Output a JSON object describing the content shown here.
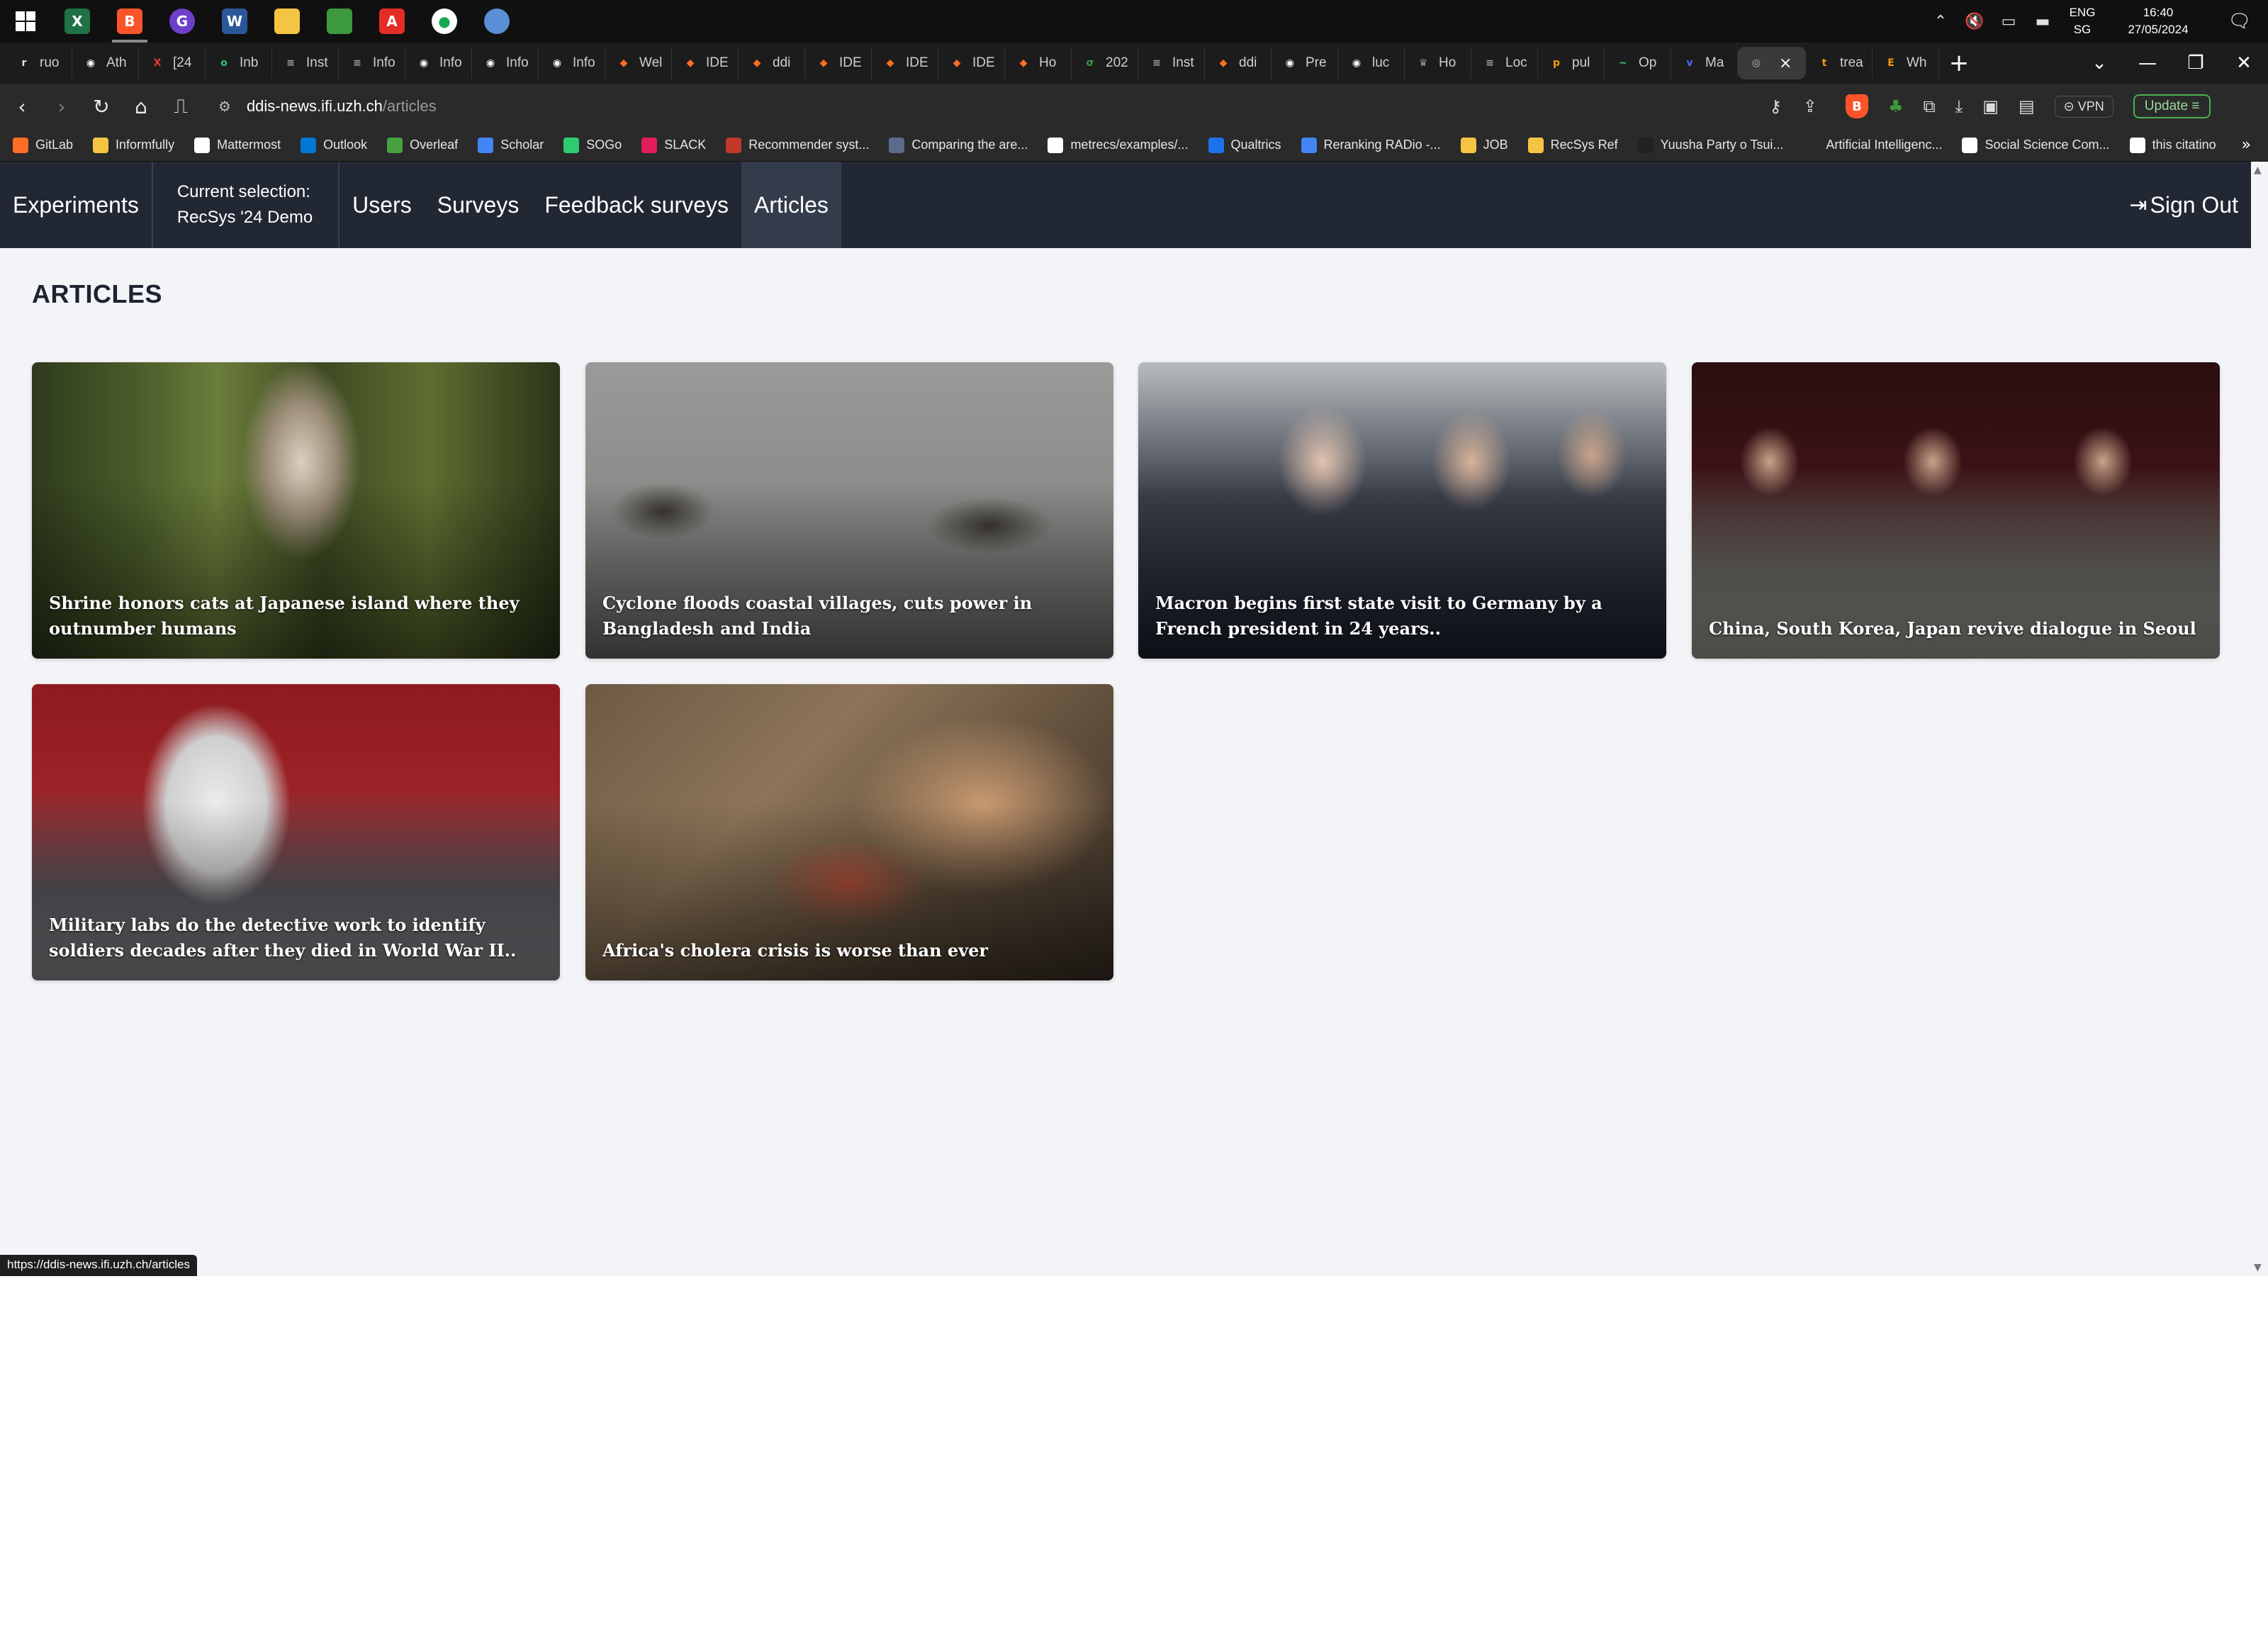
{
  "taskbar": {
    "apps": [
      {
        "icon": "windows-start-icon",
        "color": "#ffffff",
        "glyph": ""
      },
      {
        "icon": "excel-icon",
        "color": "#1f7244",
        "glyph": "X"
      },
      {
        "icon": "brave-browser-icon",
        "color": "#fb542b",
        "glyph": "B"
      },
      {
        "icon": "github-desktop-icon",
        "color": "#6e40c9",
        "glyph": "G"
      },
      {
        "icon": "word-icon",
        "color": "#2b579a",
        "glyph": "W"
      },
      {
        "icon": "file-explorer-icon",
        "color": "#f4c542",
        "glyph": ""
      },
      {
        "icon": "notepad-icon",
        "color": "#3c9a3c",
        "glyph": ""
      },
      {
        "icon": "acrobat-icon",
        "color": "#e52d27",
        "glyph": "A"
      },
      {
        "icon": "mongodb-compass-icon",
        "color": "#ffffff",
        "glyph": ""
      },
      {
        "icon": "paint-icon",
        "color": "#5a8fd6",
        "glyph": ""
      }
    ],
    "tray": {
      "lang_line1": "ENG",
      "lang_line2": "SG",
      "time": "16:40",
      "date": "27/05/2024"
    }
  },
  "tabs": [
    {
      "label": "ruo",
      "color": "#e5e5e5",
      "glyph": "r"
    },
    {
      "label": "Ath",
      "color": "#ffffff",
      "glyph": "◉"
    },
    {
      "label": "[24",
      "color": "#e53935",
      "glyph": "X"
    },
    {
      "label": "Inb",
      "color": "#2ecc71",
      "glyph": "o"
    },
    {
      "label": "Inst",
      "color": "#9ea7b3",
      "glyph": "≡"
    },
    {
      "label": "Info",
      "color": "#9ea7b3",
      "glyph": "≡"
    },
    {
      "label": "Info",
      "color": "#ffffff",
      "glyph": "◉"
    },
    {
      "label": "Info",
      "color": "#ffffff",
      "glyph": "◉"
    },
    {
      "label": "Info",
      "color": "#ffffff",
      "glyph": "◉"
    },
    {
      "label": "Wel",
      "color": "#fc6d26",
      "glyph": "◆"
    },
    {
      "label": "IDE",
      "color": "#fc6d26",
      "glyph": "◆"
    },
    {
      "label": "ddi",
      "color": "#fc6d26",
      "glyph": "◆"
    },
    {
      "label": "IDE",
      "color": "#fc6d26",
      "glyph": "◆"
    },
    {
      "label": "IDE",
      "color": "#fc6d26",
      "glyph": "◆"
    },
    {
      "label": "IDE",
      "color": "#fc6d26",
      "glyph": "◆"
    },
    {
      "label": "Ho",
      "color": "#fc6d26",
      "glyph": "◆"
    },
    {
      "label": "202",
      "color": "#3c9a3c",
      "glyph": "σ"
    },
    {
      "label": "Inst",
      "color": "#9ea7b3",
      "glyph": "≡"
    },
    {
      "label": "ddi",
      "color": "#fc6d26",
      "glyph": "◆"
    },
    {
      "label": "Pre",
      "color": "#ffffff",
      "glyph": "◉"
    },
    {
      "label": "luc",
      "color": "#ffffff",
      "glyph": "◉"
    },
    {
      "label": "Ho",
      "color": "#9a9a9a",
      "glyph": "♛"
    },
    {
      "label": "Loc",
      "color": "#9ea7b3",
      "glyph": "≡"
    },
    {
      "label": "pul",
      "color": "#f39c12",
      "glyph": "p"
    },
    {
      "label": "Op",
      "color": "#2ecc71",
      "glyph": "~"
    },
    {
      "label": "Ma",
      "color": "#4a6cf7",
      "glyph": "v"
    },
    {
      "label": "",
      "color": "#bbbbbb",
      "glyph": "◎",
      "active": true
    },
    {
      "label": "trea",
      "color": "#f39c12",
      "glyph": "t"
    },
    {
      "label": "Wh",
      "color": "#f39c12",
      "glyph": "E"
    }
  ],
  "window_controls": {
    "chevron": "⌄",
    "minimize": "—",
    "restore": "❐",
    "close": "✕"
  },
  "address_bar": {
    "host": "ddis-news.ifi.uzh.ch",
    "path": "/articles",
    "vpn_label": "VPN",
    "update_label": "Update"
  },
  "bookmarks": [
    {
      "label": "GitLab",
      "icon": "gitlab-icon",
      "color": "#fc6d26"
    },
    {
      "label": "Informfully",
      "icon": "folder-icon",
      "color": "#f4c542"
    },
    {
      "label": "Mattermost",
      "icon": "mattermost-icon",
      "color": "#ffffff"
    },
    {
      "label": "Outlook",
      "icon": "outlook-icon",
      "color": "#0078d4"
    },
    {
      "label": "Overleaf",
      "icon": "overleaf-icon",
      "color": "#47a141"
    },
    {
      "label": "Scholar",
      "icon": "scholar-icon",
      "color": "#4285f4"
    },
    {
      "label": "SOGo",
      "icon": "sogo-icon",
      "color": "#2ecc71"
    },
    {
      "label": "SLACK",
      "icon": "slack-icon",
      "color": "#e01e5a"
    },
    {
      "label": "Recommender syst...",
      "icon": "springer-icon",
      "color": "#c0392b"
    },
    {
      "label": "Comparing the are...",
      "icon": "doc-icon",
      "color": "#5a6b8c"
    },
    {
      "label": "metrecs/examples/...",
      "icon": "github-icon",
      "color": "#ffffff"
    },
    {
      "label": "Qualtrics",
      "icon": "qualtrics-icon",
      "color": "#1a73e8"
    },
    {
      "label": "Reranking RADio -...",
      "icon": "docs-icon",
      "color": "#4285f4"
    },
    {
      "label": "JOB",
      "icon": "folder-icon",
      "color": "#f4c542"
    },
    {
      "label": "RecSys Ref",
      "icon": "folder-icon",
      "color": "#f4c542"
    },
    {
      "label": "Yuusha Party o Tsui...",
      "icon": "manga-icon",
      "color": "#222222"
    },
    {
      "label": "Artificial Intelligenc...",
      "icon": "underline-icon",
      "color": "#2a2a2a"
    },
    {
      "label": "Social Science Com...",
      "icon": "globe-icon",
      "color": "#ffffff"
    },
    {
      "label": "this citatino",
      "icon": "github-icon",
      "color": "#ffffff"
    }
  ],
  "app": {
    "brand": "Experiments",
    "selection_label": "Current selection:",
    "selection_value": "RecSys '24 Demo",
    "nav": [
      "Users",
      "Surveys",
      "Feedback surveys",
      "Articles"
    ],
    "active_nav": "Articles",
    "sign_out": "Sign Out"
  },
  "page": {
    "title": "ARTICLES"
  },
  "articles": [
    {
      "title": "Shrine honors cats at Japanese island where they outnumber humans",
      "image": "shrine"
    },
    {
      "title": "Cyclone floods coastal villages, cuts power in Bangladesh and India",
      "image": "cyclone"
    },
    {
      "title": "Macron begins first state visit to Germany by a French president in 24 years..",
      "image": "macron"
    },
    {
      "title": "China, South Korea, Japan revive dialogue in Seoul",
      "image": "seoul"
    },
    {
      "title": "Military labs do the detective work to identify soldiers decades after they died in World War II..",
      "image": "military"
    },
    {
      "title": "Africa's cholera crisis is worse than ever",
      "image": "cholera"
    }
  ],
  "status_url": "https://ddis-news.ifi.uzh.ch/articles"
}
